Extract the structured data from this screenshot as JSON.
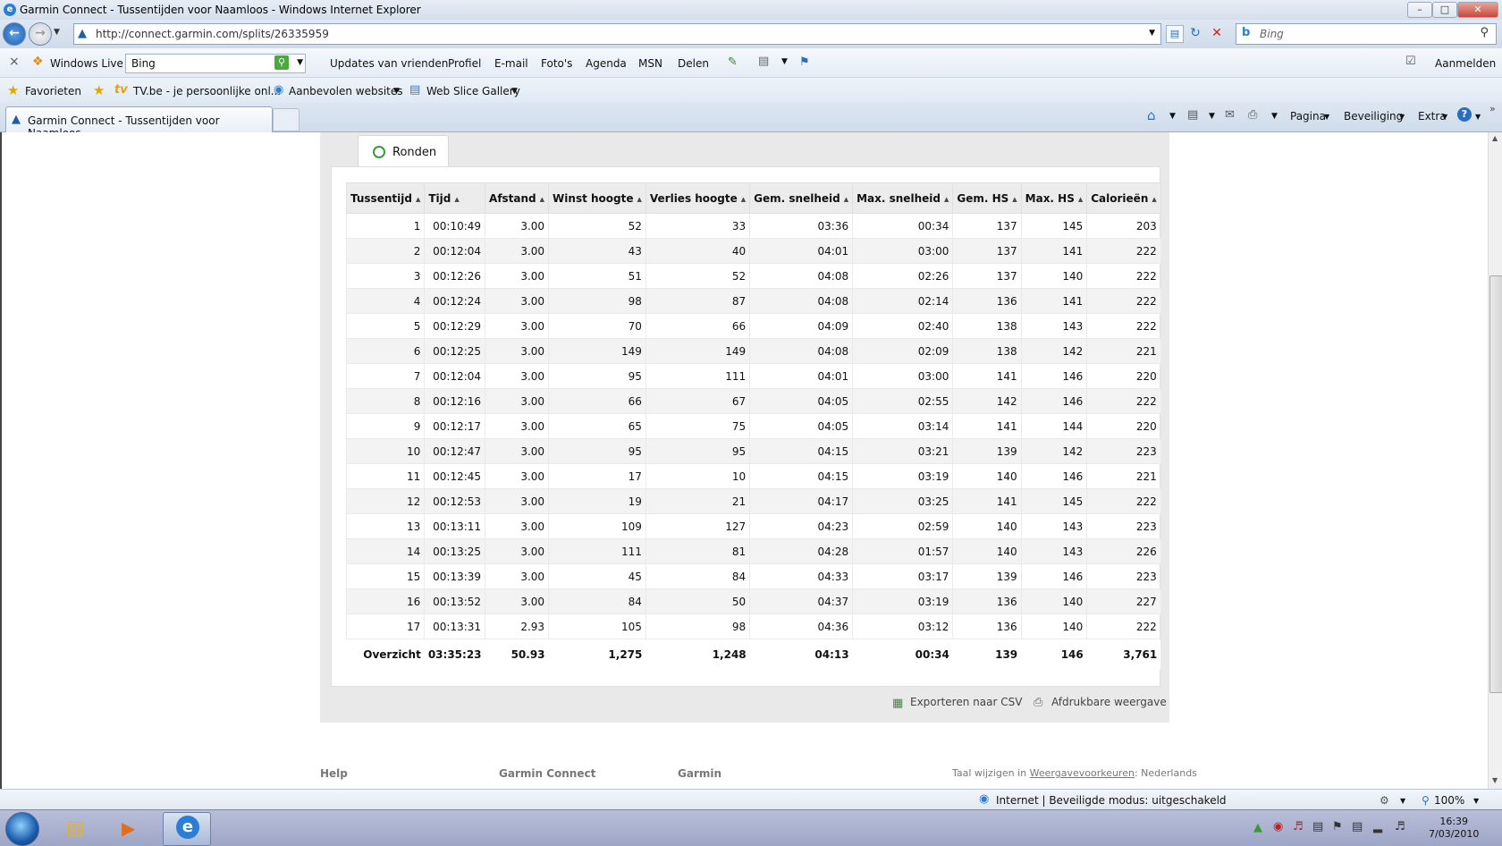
{
  "window": {
    "title": "Garmin Connect - Tussentijden voor Naamloos - Windows Internet Explorer"
  },
  "address": {
    "url": "http://connect.garmin.com/splits/26335959",
    "search_placeholder": "Bing"
  },
  "live_toolbar": {
    "brand": "Windows Live",
    "search_value": "Bing",
    "links": [
      "Updates van vrienden",
      "Profiel",
      "E-mail",
      "Foto's",
      "Agenda",
      "MSN",
      "Delen"
    ],
    "signin": "Aanmelden"
  },
  "favorites_bar": {
    "favorites": "Favorieten",
    "items": [
      "TV.be - je persoonlijke onl...",
      "Aanbevolen websites",
      "Web Slice Gallery"
    ]
  },
  "tabs": {
    "active": "Garmin Connect - Tussentijden voor Naamloos",
    "commands": [
      "Pagina",
      "Beveiliging",
      "Extra"
    ]
  },
  "page": {
    "tab_label": "Ronden",
    "columns": [
      "Tussentijd",
      "Tijd",
      "Afstand",
      "Winst hoogte",
      "Verlies hoogte",
      "Gem. snelheid",
      "Max. snelheid",
      "Gem. HS",
      "Max. HS",
      "Calorieën"
    ],
    "rows": [
      [
        "1",
        "00:10:49",
        "3.00",
        "52",
        "33",
        "03:36",
        "00:34",
        "137",
        "145",
        "203"
      ],
      [
        "2",
        "00:12:04",
        "3.00",
        "43",
        "40",
        "04:01",
        "03:00",
        "137",
        "141",
        "222"
      ],
      [
        "3",
        "00:12:26",
        "3.00",
        "51",
        "52",
        "04:08",
        "02:26",
        "137",
        "140",
        "222"
      ],
      [
        "4",
        "00:12:24",
        "3.00",
        "98",
        "87",
        "04:08",
        "02:14",
        "136",
        "141",
        "222"
      ],
      [
        "5",
        "00:12:29",
        "3.00",
        "70",
        "66",
        "04:09",
        "02:40",
        "138",
        "143",
        "222"
      ],
      [
        "6",
        "00:12:25",
        "3.00",
        "149",
        "149",
        "04:08",
        "02:09",
        "138",
        "142",
        "221"
      ],
      [
        "7",
        "00:12:04",
        "3.00",
        "95",
        "111",
        "04:01",
        "03:00",
        "141",
        "146",
        "220"
      ],
      [
        "8",
        "00:12:16",
        "3.00",
        "66",
        "67",
        "04:05",
        "02:55",
        "142",
        "146",
        "222"
      ],
      [
        "9",
        "00:12:17",
        "3.00",
        "65",
        "75",
        "04:05",
        "03:14",
        "141",
        "144",
        "220"
      ],
      [
        "10",
        "00:12:47",
        "3.00",
        "95",
        "95",
        "04:15",
        "03:21",
        "139",
        "142",
        "223"
      ],
      [
        "11",
        "00:12:45",
        "3.00",
        "17",
        "10",
        "04:15",
        "03:19",
        "140",
        "146",
        "221"
      ],
      [
        "12",
        "00:12:53",
        "3.00",
        "19",
        "21",
        "04:17",
        "03:25",
        "141",
        "145",
        "222"
      ],
      [
        "13",
        "00:13:11",
        "3.00",
        "109",
        "127",
        "04:23",
        "02:59",
        "140",
        "143",
        "223"
      ],
      [
        "14",
        "00:13:25",
        "3.00",
        "111",
        "81",
        "04:28",
        "01:57",
        "140",
        "143",
        "226"
      ],
      [
        "15",
        "00:13:39",
        "3.00",
        "45",
        "84",
        "04:33",
        "03:17",
        "139",
        "146",
        "223"
      ],
      [
        "16",
        "00:13:52",
        "3.00",
        "84",
        "50",
        "04:37",
        "03:19",
        "136",
        "140",
        "227"
      ],
      [
        "17",
        "00:13:31",
        "2.93",
        "105",
        "98",
        "04:36",
        "03:12",
        "136",
        "140",
        "222"
      ]
    ],
    "total": [
      "Overzicht",
      "03:35:23",
      "50.93",
      "1,275",
      "1,248",
      "04:13",
      "00:34",
      "139",
      "146",
      "3,761"
    ],
    "export_csv": "Exporteren naar CSV",
    "printable": "Afdrukbare weergave"
  },
  "footer": {
    "help": "Help",
    "garmin_connect": "Garmin Connect",
    "garmin": "Garmin",
    "lang_prefix": "Taal wijzigen in ",
    "lang_link": "Weergavevoorkeuren",
    "lang_value": ": Nederlands"
  },
  "statusbar": {
    "zone": "Internet | Beveiligde modus: uitgeschakeld",
    "zoom": "100%"
  },
  "taskbar": {
    "time": "16:39",
    "date": "7/03/2010"
  },
  "colors": {
    "accent": "#2a7fd4",
    "panel_bg": "#e9e9e9",
    "taskbar": "#a9b0cf"
  }
}
